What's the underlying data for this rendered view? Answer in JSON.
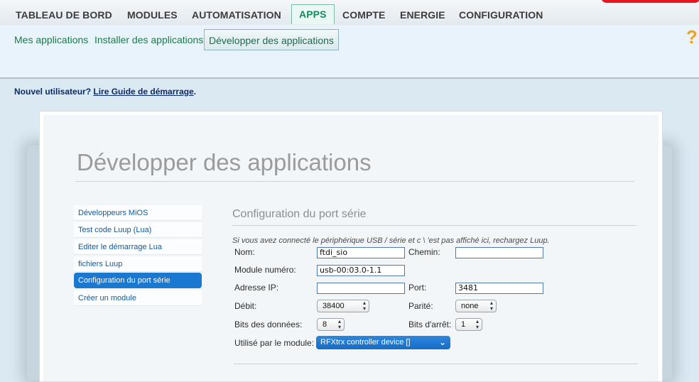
{
  "topnav": {
    "tabs": [
      "TABLEAU DE BORD",
      "MODULES",
      "AUTOMATISATION",
      "APPS",
      "COMPTE",
      "ENERGIE",
      "CONFIGURATION"
    ],
    "active": "APPS"
  },
  "subnav": {
    "items": [
      "Mes applications",
      "Installer des applications",
      "Développer des applications"
    ],
    "active": "Développer des applications",
    "help_icon": "question-mark-icon"
  },
  "newuser": {
    "prefix": "Nouvel utilisateur? ",
    "link": "Lire Guide de démarrage",
    "suffix": "."
  },
  "page": {
    "title": "Développer des applications"
  },
  "sidemenu": {
    "items": [
      "Développeurs MiOS",
      "Test code Luup (Lua)",
      "Editer le démarrage Lua",
      "fichiers Luup",
      "Configuration du port série",
      "Créer un module"
    ],
    "active": "Configuration du port série"
  },
  "serial": {
    "section_title": "Configuration du port série",
    "note": "Si vous avez connecté le périphérique USB / série et c \\ 'est pas affiché ici, rechargez Luup.",
    "labels": {
      "nom": "Nom:",
      "chemin": "Chemin:",
      "module_num": "Module numéro:",
      "ip": "Adresse IP:",
      "port": "Port:",
      "debit": "Débit:",
      "parite": "Parité:",
      "bits_donnees": "Bits des données:",
      "bits_arret": "Bits d'arrêt:",
      "utilise": "Utilisé par le module:"
    },
    "values": {
      "nom": "ftdi_sio",
      "chemin": "",
      "module_num": "usb-00:03.0-1.1",
      "ip": "",
      "port": "3481",
      "debit": "38400",
      "parite": "none",
      "bits_donnees": "8",
      "bits_arret": "1",
      "utilise": "RFXtrx controller device []"
    }
  },
  "colors": {
    "accent_green": "#1d7a4a",
    "link_blue": "#155a9c",
    "selected_blue": "#1b78d0",
    "help_orange": "#f3a21b"
  }
}
